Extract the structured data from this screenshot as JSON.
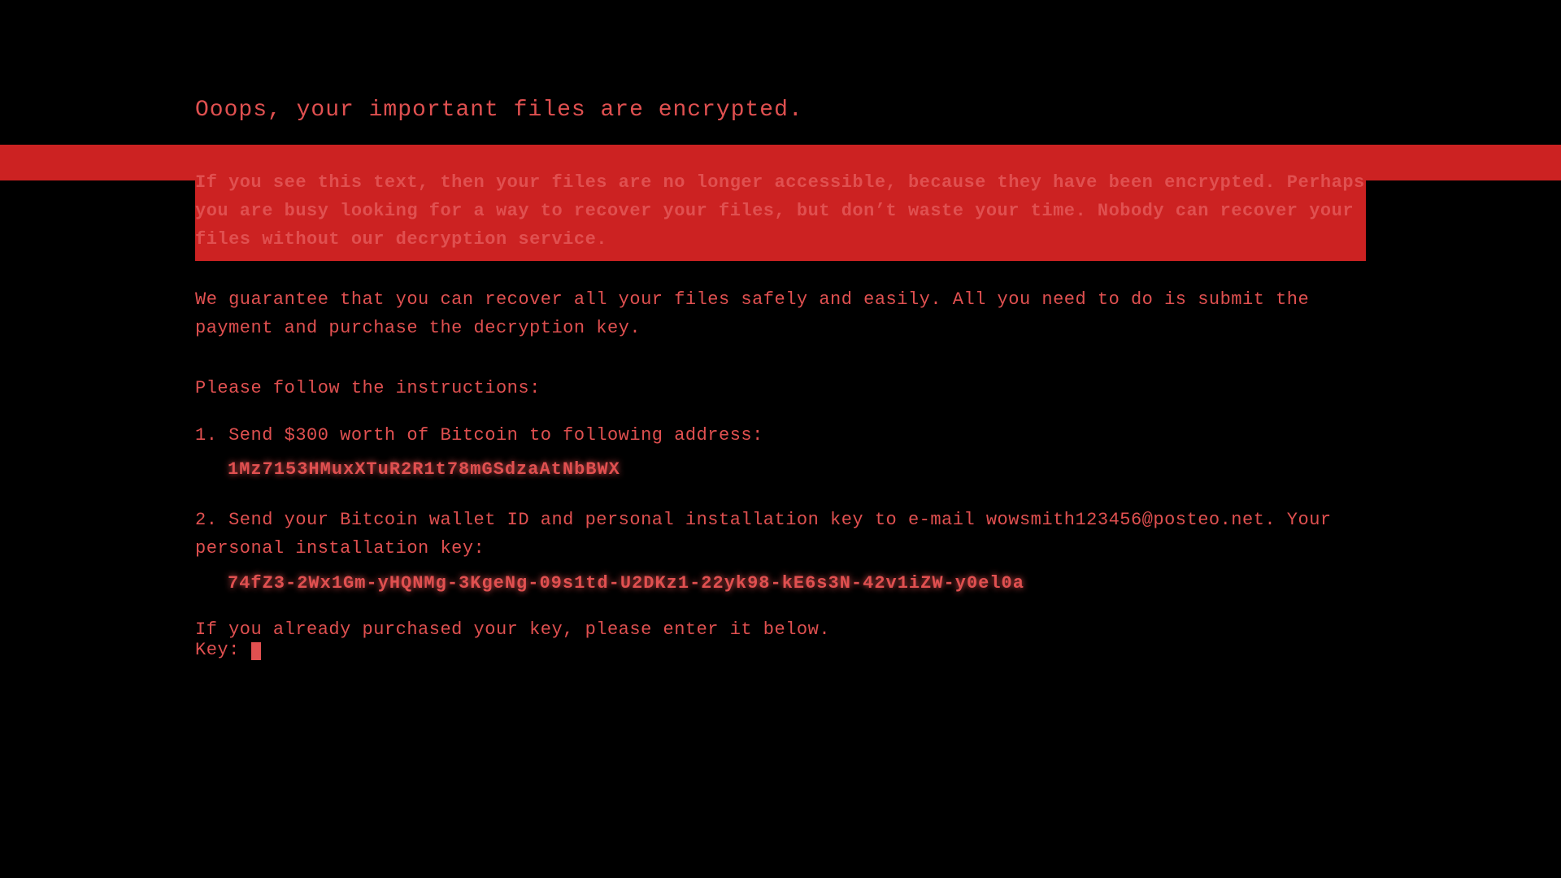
{
  "ransomware": {
    "title": "Ooops, your important files are encrypted.",
    "highlight_paragraph": "If you see this text, then your files are no longer accessible, because they have been encrypted.  Perhaps you are busy looking for a way to recover your files, but don’t waste your time.  Nobody can recover your files without our decryption service.",
    "guarantee_text": "We guarantee that you can recover all your files safely and easily.  All you need to do is submit the payment and purchase the decryption key.",
    "instruction_header": "Please follow the instructions:",
    "step1_label": "1. Send $300 worth of Bitcoin to following address:",
    "bitcoin_address": "1Mz7153HMuxXTuR2R1t78mGSdzaAtNbBWX",
    "step2_label": "2. Send your Bitcoin wallet ID and personal installation key to e-mail wowsmith123456@posteo.net. Your personal installation key:",
    "install_key": "74fZ3-2Wx1Gm-yHQNMg-3KgeNg-09s1td-U2DKz1-22yk98-kE6s3N-42v1iZW-y0el0a",
    "key_entry_text": "If you already purchased your key, please enter it below.",
    "key_prompt": "Key: _"
  }
}
